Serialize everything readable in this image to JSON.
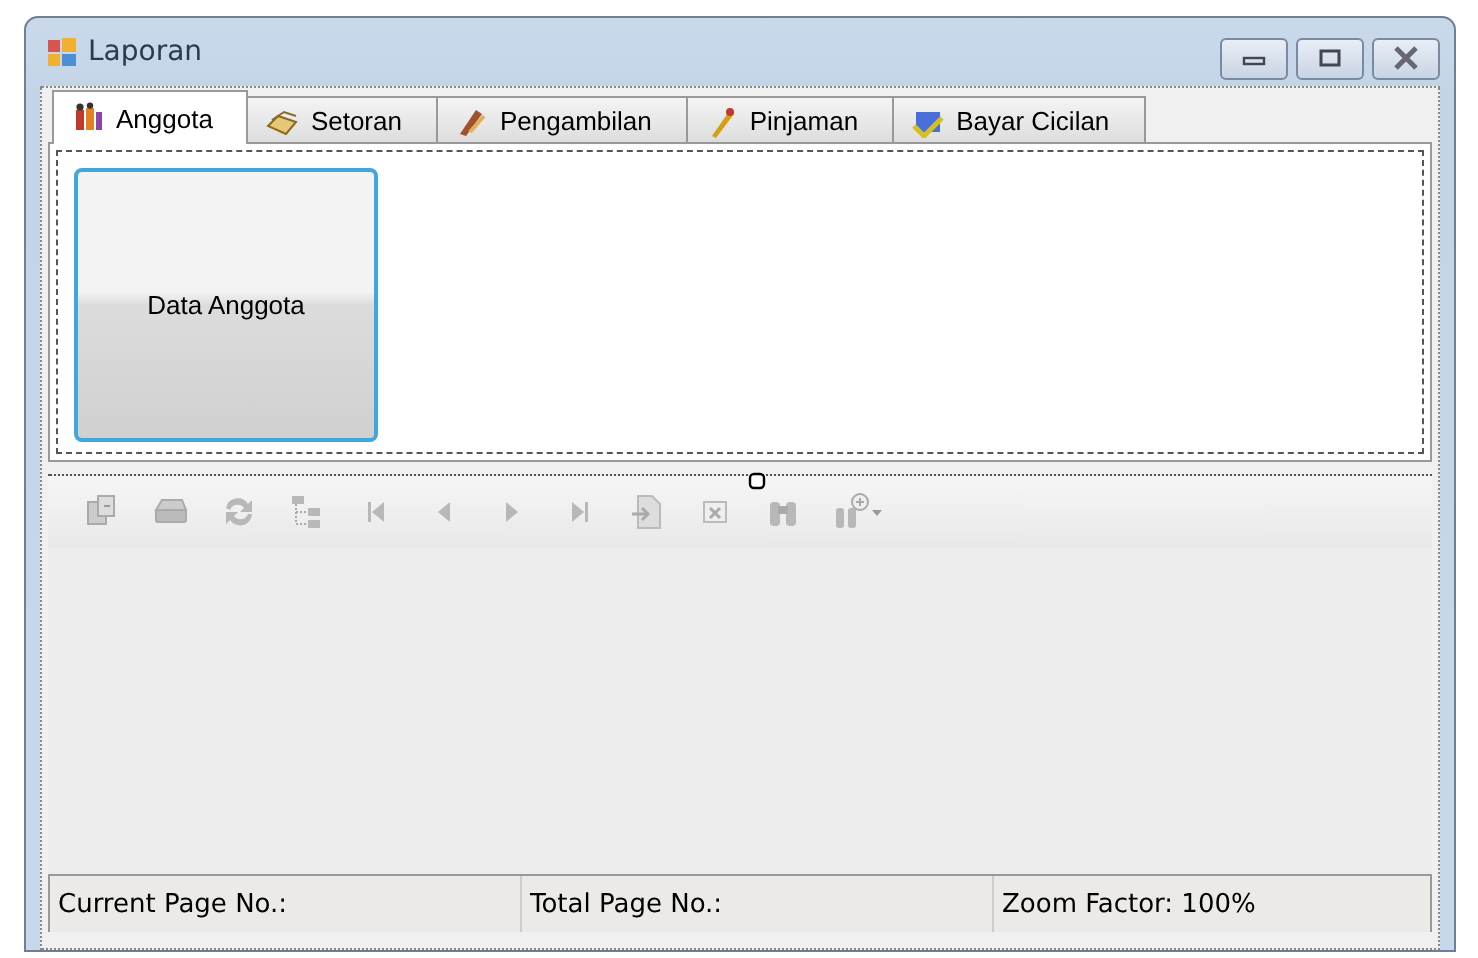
{
  "window": {
    "title": "Laporan"
  },
  "tabs": [
    {
      "label": "Anggota",
      "selected": true
    },
    {
      "label": "Setoran",
      "selected": false
    },
    {
      "label": "Pengambilan",
      "selected": false
    },
    {
      "label": "Pinjaman",
      "selected": false
    },
    {
      "label": "Bayar Cicilan",
      "selected": false
    }
  ],
  "panel": {
    "button": "Data Anggota"
  },
  "status_bar": [
    "Current Page No.:",
    "Total Page No.:",
    "Zoom Factor: 100%"
  ]
}
